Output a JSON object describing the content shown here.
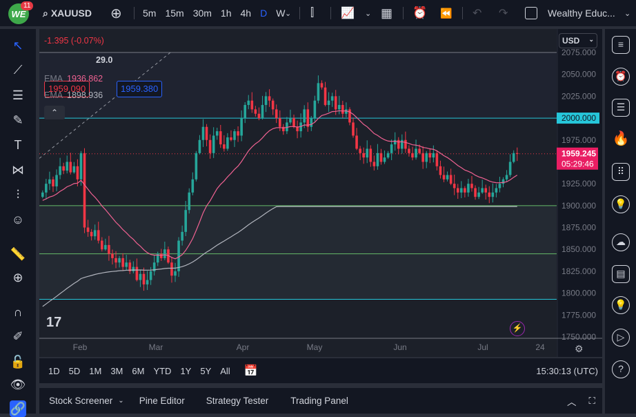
{
  "topbar": {
    "logo": "WE",
    "notifications": "11",
    "symbol": "XAUUSD",
    "timeframes": [
      "5m",
      "15m",
      "30m",
      "1h",
      "4h",
      "D",
      "W"
    ],
    "active_timeframe": "D",
    "account": "Wealthy Educ..."
  },
  "legend": {
    "change": "-1.395 (-0.07%)",
    "bid": "1959.090",
    "spread": "29.0",
    "ask": "1959.380",
    "ema1_label": "EMA",
    "ema1_value": "1936.862",
    "ema2_label": "EMA",
    "ema2_value": "1898.936"
  },
  "price_axis": {
    "currency": "USD",
    "ticks": [
      "2075.000",
      "2050.000",
      "2025.000",
      "2000.000",
      "1975.000",
      "1950.000",
      "1925.000",
      "1900.000",
      "1875.000",
      "1850.000",
      "1825.000",
      "1800.000",
      "1775.000",
      "1750.000"
    ],
    "level_label": "2000.000",
    "last_price": "1959.245",
    "countdown": "05:29:46"
  },
  "time_axis": {
    "ticks": [
      "Feb",
      "Mar",
      "Apr",
      "May",
      "Jun",
      "Jul",
      "24"
    ]
  },
  "range_bar": {
    "ranges": [
      "1D",
      "5D",
      "1M",
      "3M",
      "6M",
      "YTD",
      "1Y",
      "5Y",
      "All"
    ],
    "clock": "15:30:13 (UTC)"
  },
  "bottom_panel": {
    "tabs": [
      "Stock Screener",
      "Pine Editor",
      "Strategy Tester",
      "Trading Panel"
    ]
  },
  "colors": {
    "up": "#26a69a",
    "down": "#f23645",
    "ema_fast": "#f06292",
    "ema_slow": "#b2b5be",
    "level": "#26c6da",
    "support": "#66bb6a",
    "accent": "#2962ff"
  },
  "chart_data": {
    "type": "candlestick",
    "symbol": "XAUUSD",
    "ylim": [
      1750,
      2075
    ],
    "closes": [
      1915,
      1925,
      1930,
      1922,
      1935,
      1945,
      1940,
      1950,
      1938,
      1945,
      1930,
      1960,
      1875,
      1870,
      1865,
      1872,
      1860,
      1850,
      1855,
      1845,
      1840,
      1835,
      1840,
      1830,
      1835,
      1825,
      1830,
      1815,
      1822,
      1810,
      1815,
      1825,
      1835,
      1845,
      1840,
      1850,
      1835,
      1820,
      1825,
      1860,
      1870,
      1895,
      1915,
      1930,
      1960,
      1975,
      1990,
      1975,
      1960,
      1980,
      1985,
      1970,
      1965,
      1978,
      1975,
      1985,
      1980,
      2000,
      2015,
      2020,
      2010,
      2005,
      2000,
      2015,
      2025,
      2020,
      2010,
      2000,
      1990,
      1985,
      1995,
      2000,
      1990,
      1985,
      1995,
      2010,
      1990,
      2000,
      2020,
      2040,
      2035,
      2015,
      2020,
      2025,
      2010,
      2015,
      2005,
      2010,
      1995,
      1980,
      1965,
      1960,
      1955,
      1965,
      1950,
      1945,
      1960,
      1950,
      1955,
      1960,
      1970,
      1975,
      1965,
      1975,
      1965,
      1960,
      1955,
      1965,
      1960,
      1950,
      1960,
      1955,
      1960,
      1945,
      1935,
      1930,
      1935,
      1925,
      1920,
      1915,
      1920,
      1915,
      1925,
      1920,
      1910,
      1915,
      1920,
      1915,
      1910,
      1915,
      1920,
      1925,
      1930,
      1935,
      1950,
      1960,
      1959
    ],
    "horizontal_levels": [
      2075,
      2000,
      1900,
      1845,
      1793
    ]
  }
}
